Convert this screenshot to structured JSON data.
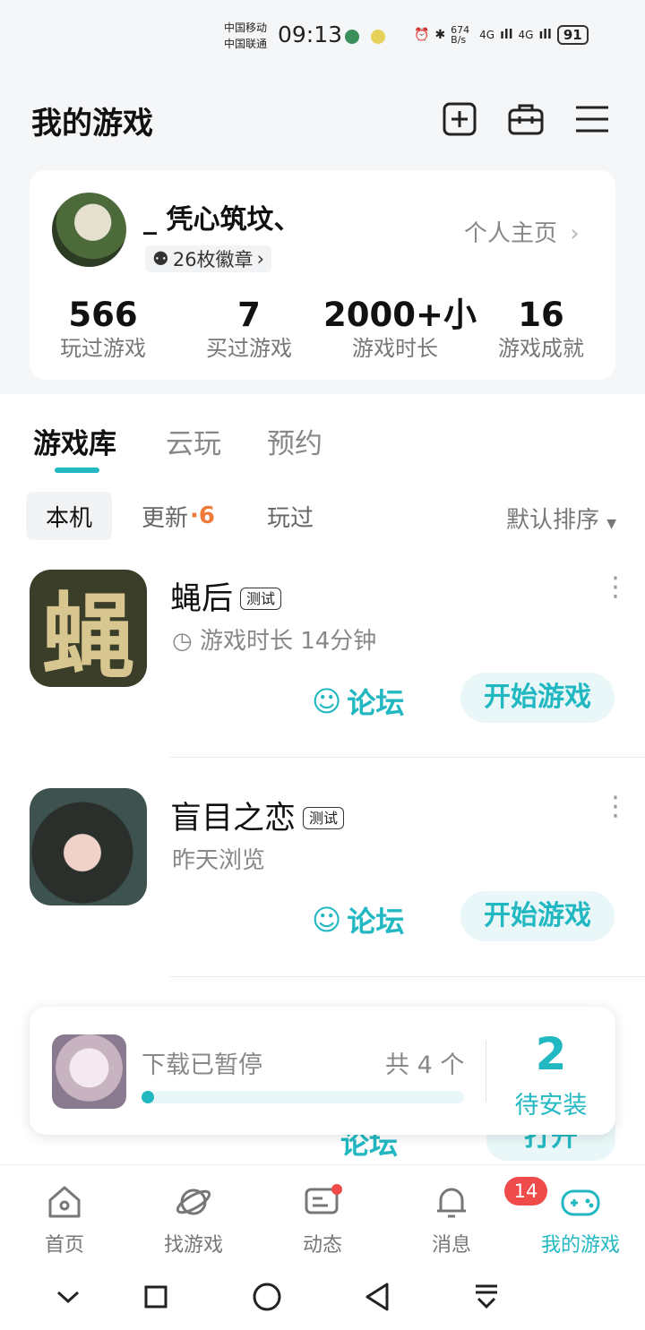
{
  "status_bar": {
    "carrier1": "中国移动",
    "carrier2": "中国联通",
    "time": "09:13",
    "net_speed": "674 B/s",
    "signal1": "4G",
    "signal2": "4G",
    "battery": "91"
  },
  "header": {
    "title": "我的游戏",
    "icons": [
      "add-icon",
      "toolbox-icon",
      "menu-icon"
    ]
  },
  "profile": {
    "username": "_ 凭心筑坟、",
    "badges": "26枚徽章",
    "homepage_link": "个人主页",
    "stats": [
      {
        "value": "566",
        "label": "玩过游戏"
      },
      {
        "value": "7",
        "label": "买过游戏"
      },
      {
        "value": "2000+小",
        "label": "游戏时长"
      },
      {
        "value": "16",
        "label": "游戏成就"
      }
    ]
  },
  "tabs": [
    "游戏库",
    "云玩",
    "预约"
  ],
  "filters": {
    "chips": [
      "本机",
      "更新",
      "玩过"
    ],
    "update_count": "6",
    "sort": "默认排序"
  },
  "games": [
    {
      "name": "蝇后",
      "tag": "测试",
      "sub": "游戏时长 14分钟",
      "icon_char": "蝇",
      "forum": "论坛",
      "action": "开始游戏"
    },
    {
      "name": "盲目之恋",
      "tag": "测试",
      "sub": "昨天浏览",
      "forum": "论坛",
      "action": "开始游戏"
    }
  ],
  "peek_game": {
    "forum": "论坛",
    "action": "打开"
  },
  "download": {
    "status": "下载已暂停",
    "total": "共 4 个",
    "progress": 0.02,
    "pending_count": "2",
    "pending_label": "待安装"
  },
  "bottom_nav": {
    "items": [
      "首页",
      "找游戏",
      "动态",
      "消息",
      "我的游戏"
    ],
    "badge": "14",
    "accent": "#22b8c2"
  }
}
